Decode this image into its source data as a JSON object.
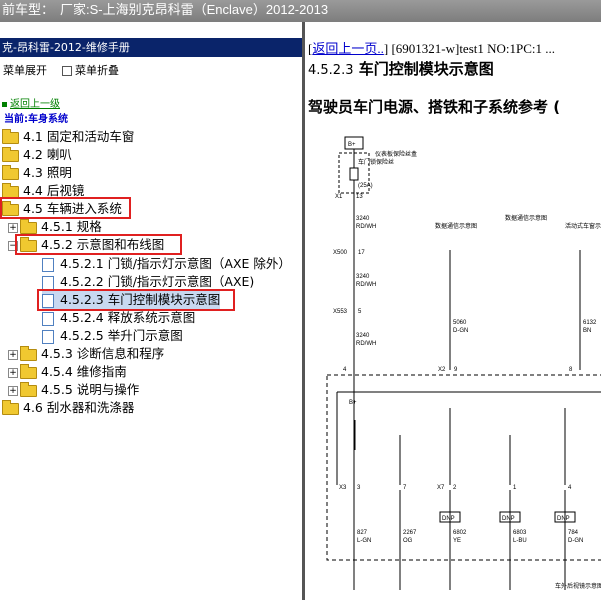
{
  "window": {
    "title_prefix": "前车型：",
    "title_vendor": "厂家:S-上海别克昂科雷（Enclave）2012-2013"
  },
  "left": {
    "manual_title": "克-昂科雷-2012-维修手册",
    "expand_label": "菜单展开",
    "collapse_label": "菜单折叠",
    "back_label": "返回上一级",
    "current_label": "当前:车身系统",
    "tree": [
      {
        "label": "4.1 固定和活动车窗"
      },
      {
        "label": "4.2 喇叭"
      },
      {
        "label": "4.3 照明"
      },
      {
        "label": "4.4 后视镜"
      },
      {
        "label": "4.5 车辆进入系统"
      },
      {
        "label": "4.5.1 规格"
      },
      {
        "label": "4.5.2 示意图和布线图"
      },
      {
        "label": "4.5.2.1 门锁/指示灯示意图（AXE 除外）"
      },
      {
        "label": "4.5.2.2 门锁/指示灯示意图（AXE)"
      },
      {
        "label": "4.5.2.3 车门控制模块示意图"
      },
      {
        "label": "4.5.2.4 释放系统示意图"
      },
      {
        "label": "4.5.2.5 举升门示意图"
      },
      {
        "label": "4.5.3 诊断信息和程序"
      },
      {
        "label": "4.5.4 维修指南"
      },
      {
        "label": "4.5.5 说明与操作"
      },
      {
        "label": "4.6 刮水器和洗涤器"
      }
    ]
  },
  "right": {
    "back_link": "返回上一页..",
    "doc_id": "] [6901321-w]test1 NO:1PC:1 ...",
    "section_number": "4.5.2.3",
    "section_title": "车门控制模块示意图",
    "subtitle": "驾驶员车门电源、搭铁和子系统参考 (",
    "diagram": {
      "b_plus": "B+",
      "fuse_box": "仪表板保险丝盒",
      "fuse_name": "车门锁保险丝",
      "fuse_rating": "(25A)",
      "conn_x1": "X1",
      "pin_13": "13",
      "wire_3240_a": "3240",
      "wire_color_a": "RD/WH",
      "conn_x500": "X500",
      "pin_17": "17",
      "wire_3240_b": "3240",
      "wire_color_b": "RD/WH",
      "conn_x553": "X553",
      "pin_5": "5",
      "wire_3240_c": "3240",
      "wire_color_c": "RD/WH",
      "data_comm": "数据通信示意图",
      "data_comm2": "数据通信示意图",
      "active_light": "活动式车窗示意图",
      "w5060": "5060",
      "c5060": "D-GN",
      "w6132": "6132",
      "c6132": "BN",
      "x1_pin4": "4",
      "x2": "X2",
      "x2_pin9": "9",
      "pin_8": "8",
      "b_plus2": "B+",
      "x3": "X3",
      "x3_pin3": "3",
      "x3_pin7": "7",
      "x7": "X7",
      "x7_pin2": "2",
      "x7_pin1": "1",
      "pin_4b": "4",
      "dnp": "DNP",
      "w827": "827",
      "c827": "L-GN",
      "w2267": "2267",
      "c2267": "OG",
      "w6802": "6802",
      "c6802": "YE",
      "w6803": "6803",
      "c6803": "L-BU",
      "w784": "784",
      "c784": "D-GN",
      "note_bottom": "车外后视镜示意图"
    }
  }
}
